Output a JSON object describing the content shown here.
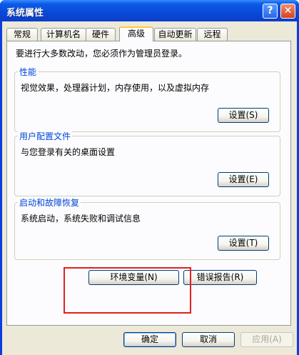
{
  "window": {
    "title": "系统属性",
    "help_glyph": "?",
    "close_glyph": "✕"
  },
  "tabs": [
    {
      "label": "常规"
    },
    {
      "label": "计算机名"
    },
    {
      "label": "硬件"
    },
    {
      "label": "高级",
      "active": true
    },
    {
      "label": "自动更新"
    },
    {
      "label": "远程"
    }
  ],
  "advanced": {
    "intro": "要进行大多数改动，您必须作为管理员登录。",
    "performance": {
      "title": "性能",
      "desc": "视觉效果，处理器计划，内存使用，以及虚拟内存",
      "button": "设置(S)"
    },
    "user_profiles": {
      "title": "用户配置文件",
      "desc": "与您登录有关的桌面设置",
      "button": "设置(E)"
    },
    "startup_recovery": {
      "title": "启动和故障恢复",
      "desc": "系统启动，系统失败和调试信息",
      "button": "设置(T)"
    },
    "env_vars_button": "环境变量(N)",
    "error_report_button": "错误报告(R)"
  },
  "footer": {
    "ok": "确定",
    "cancel": "取消",
    "apply": "应用(A)"
  },
  "colors": {
    "title_bar": "#0a4ad8",
    "dialog_bg": "#ece9d8",
    "group_title": "#0046d5",
    "annotation": "#e02020"
  }
}
